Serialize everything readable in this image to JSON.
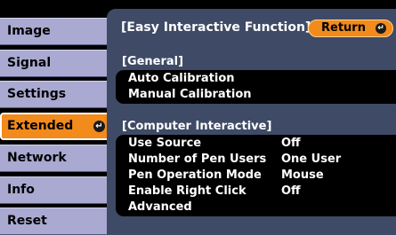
{
  "menu": {
    "items": [
      {
        "label": "Image"
      },
      {
        "label": "Signal"
      },
      {
        "label": "Settings"
      },
      {
        "label": "Extended",
        "active": true
      },
      {
        "label": "Network"
      },
      {
        "label": "Info"
      },
      {
        "label": "Reset"
      }
    ]
  },
  "panel": {
    "title": "[Easy Interactive Function]",
    "return_label": "Return",
    "general_label": "[General]",
    "general_items": [
      "Auto Calibration",
      "Manual Calibration"
    ],
    "computer_label": "[Computer Interactive]",
    "computer_items": [
      {
        "label": "Use Source",
        "value": "Off"
      },
      {
        "label": "Number of Pen Users",
        "value": "One User"
      },
      {
        "label": "Pen Operation Mode",
        "value": "Mouse"
      },
      {
        "label": "Enable Right Click",
        "value": "Off"
      },
      {
        "label": "Advanced",
        "value": ""
      }
    ]
  },
  "icons": {
    "enter": "enter-icon"
  },
  "colors": {
    "accent": "#f28a1c",
    "menu": "#a9a9d2",
    "panel": "#3f4a66"
  }
}
